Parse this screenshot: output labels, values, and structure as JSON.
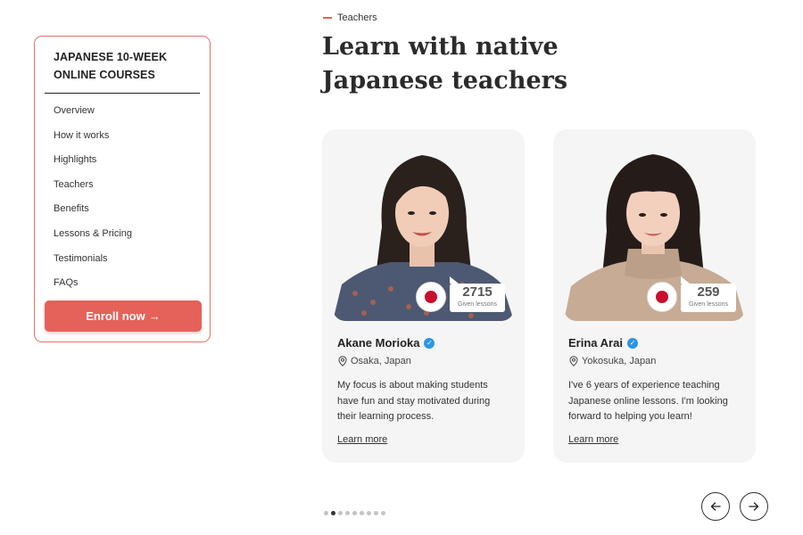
{
  "sidebar": {
    "title_line1": "JAPANESE 10-WEEK",
    "title_line2": "ONLINE COURSES",
    "items": [
      {
        "label": "Overview"
      },
      {
        "label": "How it works"
      },
      {
        "label": "Highlights"
      },
      {
        "label": "Teachers"
      },
      {
        "label": "Benefits"
      },
      {
        "label": "Lessons & Pricing"
      },
      {
        "label": "Testimonials"
      },
      {
        "label": "FAQs"
      }
    ],
    "enroll_label": "Enroll now",
    "enroll_arrow": "→"
  },
  "section": {
    "label": "Teachers",
    "title_line1": "Learn with native",
    "title_line2": "Japanese teachers"
  },
  "teachers": [
    {
      "name": "Akane Morioka",
      "location": "Osaka, Japan",
      "lessons_count": "2715",
      "lessons_label": "Given lessons",
      "bio": "My focus is about making students have fun and stay motivated during their learning process.",
      "learn_more": "Learn more"
    },
    {
      "name": "Erina Arai",
      "location": "Yokosuka, Japan",
      "lessons_count": "259",
      "lessons_label": "Given lessons",
      "bio": "I've 6 years of experience teaching Japanese online lessons. I'm looking forward to helping you learn!",
      "learn_more": "Learn more"
    }
  ],
  "pagination": {
    "total_dots": 9,
    "active_index": 1
  },
  "colors": {
    "accent": "#e5625a",
    "verified": "#2b95e9",
    "flag_red": "#c8102e"
  }
}
